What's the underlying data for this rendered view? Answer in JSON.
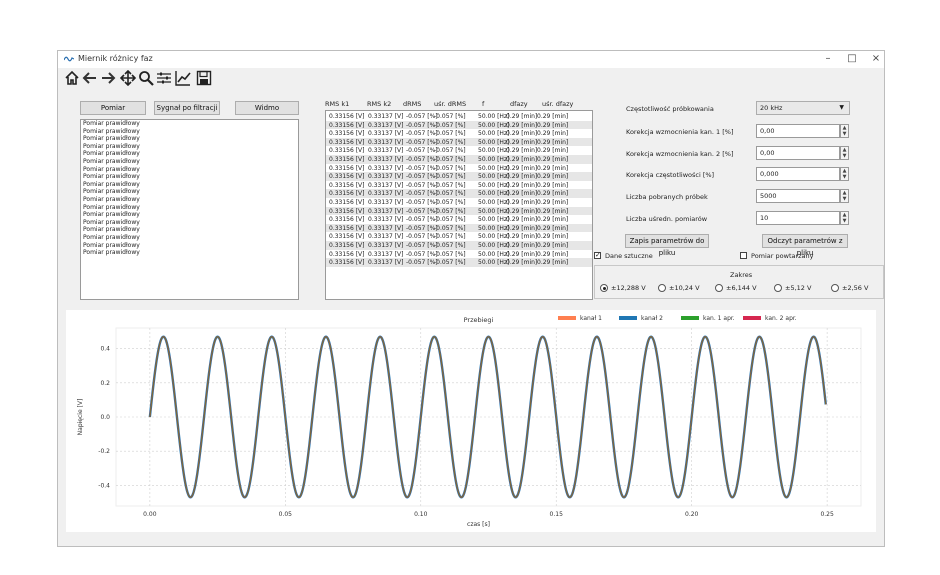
{
  "window": {
    "title": "Miernik różnicy faz",
    "controls": [
      "–",
      "□",
      "×"
    ]
  },
  "toolbar": {
    "icons": [
      "home-icon",
      "back-arrow-icon",
      "forward-arrow-icon",
      "pan-icon",
      "zoom-icon",
      "configure-subplots-icon",
      "edit-axis-icon",
      "save-icon"
    ]
  },
  "left_panel": {
    "buttons": [
      "Pomiar",
      "Sygnał po filtracji",
      "Widmo"
    ],
    "items": [
      "Pomiar prawidłowy",
      "Pomiar prawidłowy",
      "Pomiar prawidłowy",
      "Pomiar prawidłowy",
      "Pomiar prawidłowy",
      "Pomiar prawidłowy",
      "Pomiar prawidłowy",
      "Pomiar prawidłowy",
      "Pomiar prawidłowy",
      "Pomiar prawidłowy",
      "Pomiar prawidłowy",
      "Pomiar prawidłowy",
      "Pomiar prawidłowy",
      "Pomiar prawidłowy",
      "Pomiar prawidłowy",
      "Pomiar prawidłowy",
      "Pomiar prawidłowy",
      "Pomiar prawidłowy"
    ]
  },
  "table": {
    "headers": [
      "RMS k1",
      "RMS k2",
      "dRMS",
      "uśr. dRMS",
      "f",
      "dfazy",
      "uśr. dfazy"
    ],
    "rows": [
      [
        "0.33156 [V]",
        "0.33137 [V]",
        "-0.057 [%]",
        "-0.057 [%]",
        "50.00 [Hz]",
        "0.29 [min]",
        "0.29 [min]"
      ],
      [
        "0.33156 [V]",
        "0.33137 [V]",
        "-0.057 [%]",
        "-0.057 [%]",
        "50.00 [Hz]",
        "0.29 [min]",
        "0.29 [min]"
      ],
      [
        "0.33156 [V]",
        "0.33137 [V]",
        "-0.057 [%]",
        "-0.057 [%]",
        "50.00 [Hz]",
        "0.29 [min]",
        "0.29 [min]"
      ],
      [
        "0.33156 [V]",
        "0.33137 [V]",
        "-0.057 [%]",
        "-0.057 [%]",
        "50.00 [Hz]",
        "0.29 [min]",
        "0.29 [min]"
      ],
      [
        "0.33156 [V]",
        "0.33137 [V]",
        "-0.057 [%]",
        "-0.057 [%]",
        "50.00 [Hz]",
        "0.29 [min]",
        "0.29 [min]"
      ],
      [
        "0.33156 [V]",
        "0.33137 [V]",
        "-0.057 [%]",
        "-0.057 [%]",
        "50.00 [Hz]",
        "0.29 [min]",
        "0.29 [min]"
      ],
      [
        "0.33156 [V]",
        "0.33137 [V]",
        "-0.057 [%]",
        "-0.057 [%]",
        "50.00 [Hz]",
        "0.29 [min]",
        "0.29 [min]"
      ],
      [
        "0.33156 [V]",
        "0.33137 [V]",
        "-0.057 [%]",
        "-0.057 [%]",
        "50.00 [Hz]",
        "0.29 [min]",
        "0.29 [min]"
      ],
      [
        "0.33156 [V]",
        "0.33137 [V]",
        "-0.057 [%]",
        "-0.057 [%]",
        "50.00 [Hz]",
        "0.29 [min]",
        "0.29 [min]"
      ],
      [
        "0.33156 [V]",
        "0.33137 [V]",
        "-0.057 [%]",
        "-0.057 [%]",
        "50.00 [Hz]",
        "0.29 [min]",
        "0.29 [min]"
      ],
      [
        "0.33156 [V]",
        "0.33137 [V]",
        "-0.057 [%]",
        "-0.057 [%]",
        "50.00 [Hz]",
        "0.29 [min]",
        "0.29 [min]"
      ],
      [
        "0.33156 [V]",
        "0.33137 [V]",
        "-0.057 [%]",
        "-0.057 [%]",
        "50.00 [Hz]",
        "0.29 [min]",
        "0.29 [min]"
      ],
      [
        "0.33156 [V]",
        "0.33137 [V]",
        "-0.057 [%]",
        "-0.057 [%]",
        "50.00 [Hz]",
        "0.29 [min]",
        "0.29 [min]"
      ],
      [
        "0.33156 [V]",
        "0.33137 [V]",
        "-0.057 [%]",
        "-0.057 [%]",
        "50.00 [Hz]",
        "0.29 [min]",
        "0.29 [min]"
      ],
      [
        "0.33156 [V]",
        "0.33137 [V]",
        "-0.057 [%]",
        "-0.057 [%]",
        "50.00 [Hz]",
        "0.29 [min]",
        "0.29 [min]"
      ],
      [
        "0.33156 [V]",
        "0.33137 [V]",
        "-0.057 [%]",
        "-0.057 [%]",
        "50.00 [Hz]",
        "0.29 [min]",
        "0.29 [min]"
      ],
      [
        "0.33156 [V]",
        "0.33137 [V]",
        "-0.057 [%]",
        "-0.057 [%]",
        "50.00 [Hz]",
        "0.29 [min]",
        "0.29 [min]"
      ],
      [
        "0.33156 [V]",
        "0.33137 [V]",
        "-0.057 [%]",
        "-0.057 [%]",
        "50.00 [Hz]",
        "0.29 [min]",
        "0.29 [min]"
      ]
    ]
  },
  "settings": {
    "sampling_label": "Częstotliwość próbkowania",
    "sampling_value": "20 kHz",
    "corr1_label": "Korekcja wzmocnienia kan. 1 [%]",
    "corr1_value": "0,00",
    "corr2_label": "Korekcja wzmocnienia kan. 2 [%]",
    "corr2_value": "0,00",
    "freqcorr_label": "Korekcja częstotliwości [%]",
    "freqcorr_value": "0,000",
    "samples_label": "Liczba pobranych próbek",
    "samples_value": "5000",
    "avg_label": "Liczba uśredn. pomiarów",
    "avg_value": "10",
    "save_params_button": "Zapis parametrów do pliku",
    "load_params_button": "Odczyt parametrów z pliku",
    "artificial_data_label": "Dane sztuczne",
    "artificial_data_checked": true,
    "repeat_label": "Pomiar powtarzany",
    "repeat_checked": false,
    "range_title": "Zakres",
    "range_options": [
      "±12,288 V",
      "±10,24 V",
      "±6,144 V",
      "±5,12 V",
      "±2,56 V"
    ],
    "range_selected": 0
  },
  "chart_data": {
    "type": "line",
    "title": "Przebiegi",
    "xlabel": "czas [s]",
    "ylabel": "Napięcie [V]",
    "xlim": [
      -0.0125,
      0.2625
    ],
    "ylim": [
      -0.52,
      0.52
    ],
    "xticks": [
      "0.00",
      "0.05",
      "0.10",
      "0.15",
      "0.20",
      "0.25"
    ],
    "yticks": [
      "0.4",
      "0.2",
      "0.0",
      "-0.2",
      "-0.4"
    ],
    "grid": true,
    "legend_position": "top-right",
    "series": [
      {
        "name": "kanał 1",
        "color": "#ff7f50",
        "amplitude": 0.469,
        "frequency": 50,
        "x_start": 0.0,
        "x_end": 0.2495
      },
      {
        "name": "kanał 2",
        "color": "#1f77b4",
        "amplitude": 0.469,
        "frequency": 50,
        "x_start": 0.0,
        "x_end": 0.2495
      },
      {
        "name": "kan. 1 apr.",
        "color": "#2ca02c",
        "amplitude": 0.469,
        "frequency": 50,
        "x_start": 0.0,
        "x_end": 0.2495
      },
      {
        "name": "kan. 2 apr.",
        "color": "#d62750",
        "amplitude": 0.469,
        "frequency": 50,
        "x_start": 0.0,
        "x_end": 0.2495
      }
    ]
  }
}
